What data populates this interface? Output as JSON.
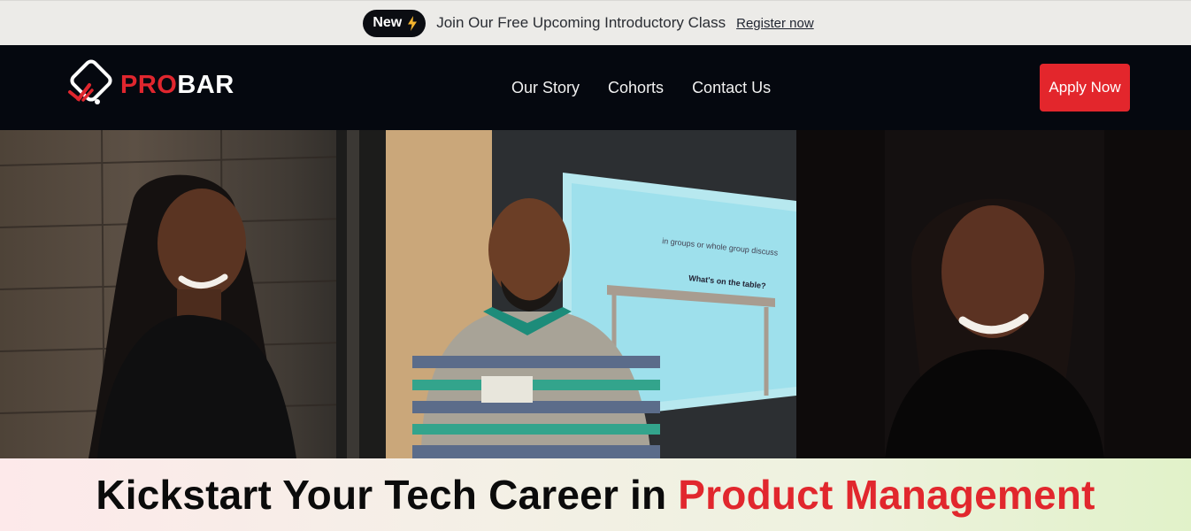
{
  "announcement": {
    "badge": "New",
    "text": "Join Our Free Upcoming Introductory Class",
    "link": "Register now"
  },
  "nav": {
    "logo": {
      "part1": "PRO",
      "part2": "BAR"
    },
    "links": [
      "Our Story",
      "Cohorts",
      "Contact Us"
    ],
    "cta": "Apply Now"
  },
  "hero": {
    "headline_part1": "Kickstart Your Tech Career in ",
    "headline_part2": "Product Management",
    "slide_text_1": "in groups or whole group discuss",
    "slide_text_2": "What's on the table?"
  },
  "colors": {
    "brand_red": "#e1272d",
    "nav_bg": "#05080f",
    "announce_bg": "#ecebe8"
  }
}
